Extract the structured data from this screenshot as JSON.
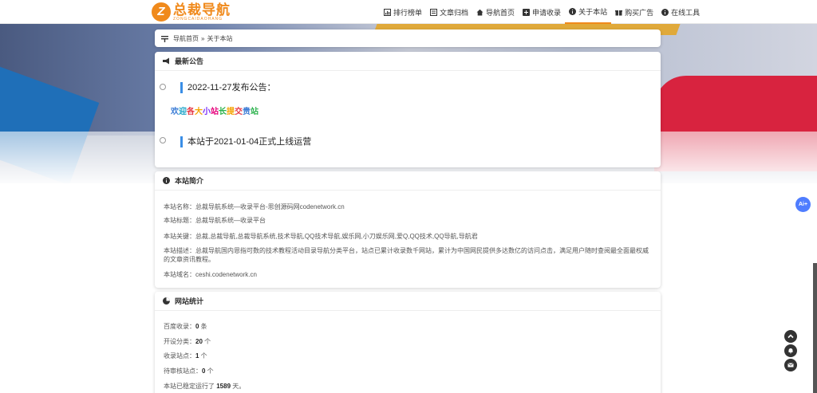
{
  "brand": {
    "logo_mark": "Z",
    "name": "总裁导航",
    "name_en": "ZONGCAIDAOHANG",
    "color": "#f08a1c"
  },
  "nav": {
    "items": [
      {
        "label": "排行榜单",
        "icon": "chart-icon"
      },
      {
        "label": "文章归档",
        "icon": "archive-icon"
      },
      {
        "label": "导航首页",
        "icon": "home-icon"
      },
      {
        "label": "申请收录",
        "icon": "plus-square-icon"
      },
      {
        "label": "关于本站",
        "icon": "info-icon",
        "active": true
      },
      {
        "label": "购买广告",
        "icon": "gift-icon"
      },
      {
        "label": "在线工具",
        "icon": "info-circle-icon"
      }
    ]
  },
  "breadcrumb": {
    "home": "导航首页",
    "separator": "»",
    "current": "关于本站"
  },
  "notice": {
    "title": "最新公告",
    "items": [
      {
        "title": "2022-11-27发布公告："
      },
      {
        "title": "本站于2021-01-04正式上线运营"
      }
    ],
    "rainbow_text": "欢迎各大小站长提交贵站",
    "rainbow_colors": [
      "#3a7bd5",
      "#1aa3c8",
      "#e63946",
      "#f4a300",
      "#7b2ff7",
      "#e6007a",
      "#2bb24c",
      "#f4a300",
      "#e63946",
      "#3a7bd5",
      "#2bb24c"
    ]
  },
  "intro": {
    "title": "本站简介",
    "lines": [
      "本站名称：总裁导航系统—收录平台-思创源码网codenetwork.cn",
      "本站标题：总裁导航系统—收录平台",
      "本站关键：总裁,总裁导航,总裁导航系统,技术导航,QQ技术导航,娱乐网,小刀娱乐网,爱Q,QQ技术,QQ导航,导航君",
      "本站描述：总裁导航国内恩指可数的技术教程活动目录导航分类平台，站点已累计收录数千网站，累计为中国网民提供多达数亿的访问点击，满足用户随时查阅最全面最权威的文章资讯教程。",
      "本站域名：ceshi.codenetwork.cn"
    ]
  },
  "stats": {
    "title": "网站统计",
    "lines": [
      {
        "label": "百度收录：",
        "value": "0",
        "unit": " 条"
      },
      {
        "label": "开设分类：",
        "value": "20",
        "unit": " 个"
      },
      {
        "label": "收录站点：",
        "value": "1",
        "unit": " 个"
      },
      {
        "label": "待审核站点：",
        "value": "0",
        "unit": " 个"
      },
      {
        "label": "本站已稳定运行了 ",
        "value": "1589",
        "unit": " 天。"
      }
    ]
  },
  "floating": {
    "ai_label": "Ai+"
  }
}
